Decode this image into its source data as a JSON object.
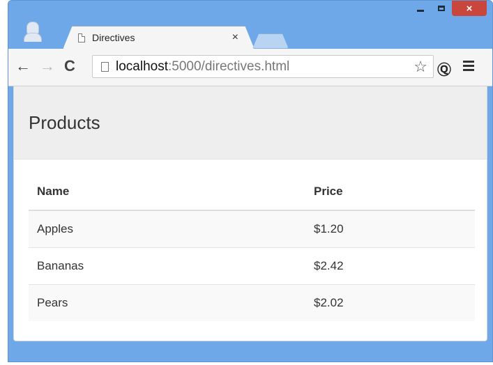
{
  "browser": {
    "tab": {
      "title": "Directives",
      "close_glyph": "×"
    },
    "controls": {
      "close_glyph": "×"
    },
    "nav": {
      "back_glyph": "←",
      "forward_glyph": "→",
      "reload_glyph": "C"
    },
    "address": {
      "host": "localhost",
      "rest": ":5000/directives.html"
    },
    "icons": {
      "star": "☆",
      "extension": "Ⓠ"
    }
  },
  "page": {
    "heading": "Products",
    "table": {
      "headers": [
        "Name",
        "Price"
      ],
      "rows": [
        {
          "name": "Apples",
          "price": "$1.20"
        },
        {
          "name": "Bananas",
          "price": "$2.42"
        },
        {
          "name": "Pears",
          "price": "$2.02"
        }
      ]
    }
  },
  "colors": {
    "titlebar": "#6fa8e8",
    "close_button": "#c9463d",
    "jumbotron": "#eeeeee"
  }
}
